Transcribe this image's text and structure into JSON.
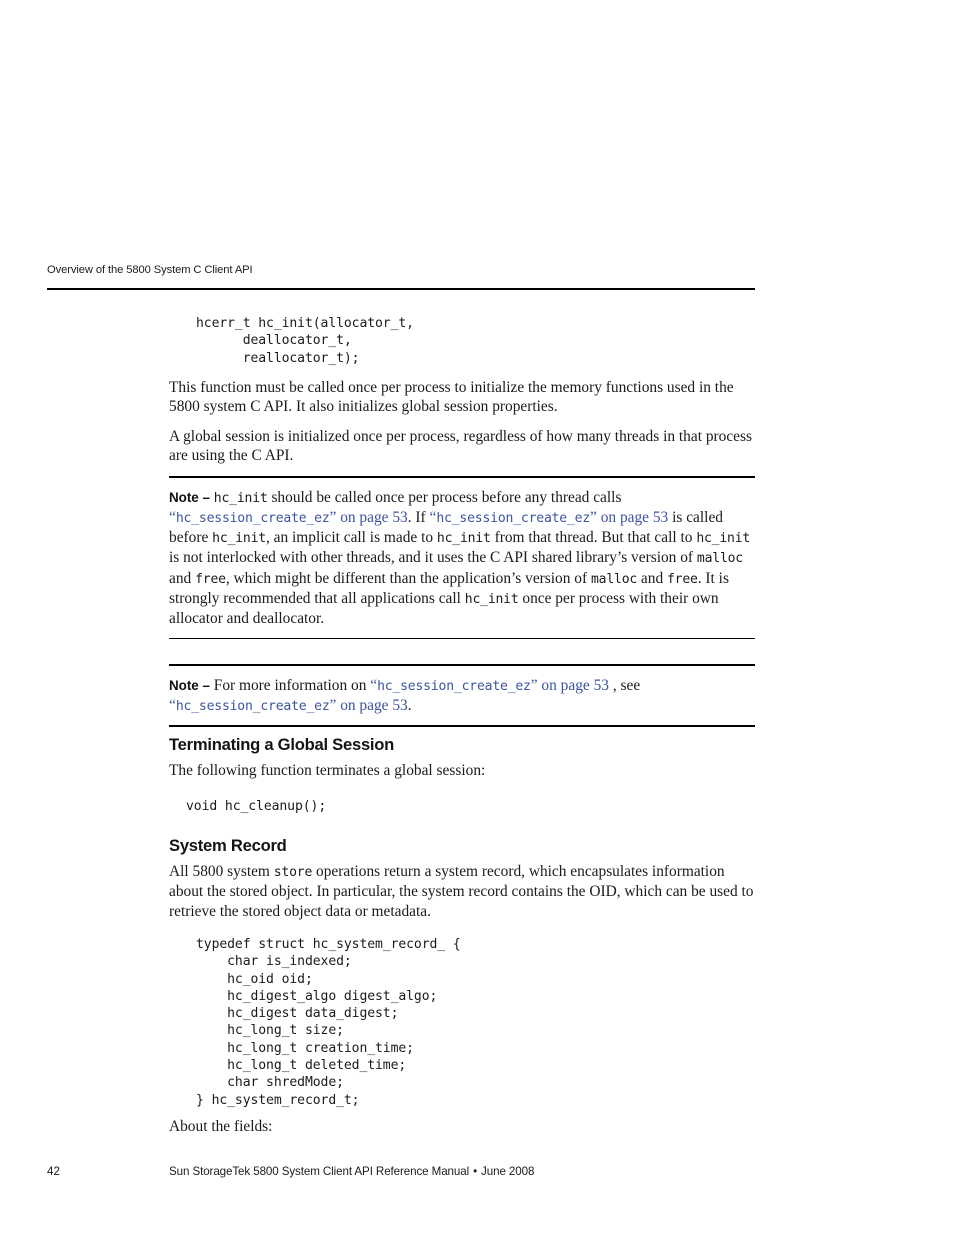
{
  "page": {
    "running_header": "Overview of the 5800 System C Client API",
    "number": "42",
    "footer_title": "Sun StorageTek 5800 System Client API Reference Manual",
    "footer_separator": "•",
    "footer_date": "June 2008",
    "link_color": "#3d53a0"
  },
  "code_blocks": {
    "hc_init_signature": "hcerr_t hc_init(allocator_t,\n      deallocator_t,\n      reallocator_t);",
    "hc_cleanup": "void hc_cleanup();",
    "system_record_struct": "typedef struct hc_system_record_ {\n    char is_indexed;\n    hc_oid oid;\n    hc_digest_algo digest_algo;\n    hc_digest data_digest;\n    hc_long_t size;\n    hc_long_t creation_time;\n    hc_long_t deleted_time;\n    char shredMode;\n} hc_system_record_t;"
  },
  "paragraphs": {
    "intro_1": "This function must be called once per process to initialize the memory functions used in the 5800 system C API. It also initializes global session properties.",
    "intro_2": "A global session is initialized once per process, regardless of how many threads in that process are using the C API.",
    "after_heading_1": "The following function terminates a global session:",
    "about_fields": "About the fields:"
  },
  "notes": {
    "note_label": "Note –",
    "note_1": {
      "seg_1": " ",
      "code_1": "hc_init",
      "seg_2": " should be called once per process before any thread calls ",
      "link_1_open_quote": "“",
      "link_1_code": "hc_session_create_ez",
      "link_1_close": "” on page 53",
      "seg_3": ". If ",
      "link_2_open_quote": "“",
      "link_2_code": "hc_session_create_ez",
      "link_2_close": "” on page 53",
      "seg_4": " is called before ",
      "code_2": "hc_init",
      "seg_5": ", an implicit call is made to ",
      "code_3": "hc_init",
      "seg_6": " from that thread. But that call to ",
      "code_4": "hc_init",
      "seg_7": " is not interlocked with other threads, and it uses the C API shared library’s version of ",
      "code_5": "malloc",
      "seg_8": " and ",
      "code_6": "free",
      "seg_9": ", which might be different than the application’s version of ",
      "code_7": "malloc",
      "seg_10": " and ",
      "code_8": "free",
      "seg_11": ". It is strongly recommended that all applications call ",
      "code_9": "hc_init",
      "seg_12": " once per process with their own allocator and deallocator."
    },
    "note_2": {
      "seg_1": " For more information on ",
      "link_1_open_quote": "“",
      "link_1_code": "hc_session_create_ez",
      "link_1_close": "” on page 53",
      "seg_2": " , see ",
      "link_2_open_quote": "“",
      "link_2_code": "hc_session_create_ez",
      "link_2_close": "” on page 53",
      "seg_3": "."
    }
  },
  "headings": {
    "terminating_a_global_session": "Terminating a Global Session",
    "system_record": "System Record"
  },
  "system_record_text": {
    "seg_1": "All 5800 system ",
    "code_1": "store",
    "seg_2": " operations return a system record, which encapsulates information about the stored object. In particular, the system record contains the OID, which can be used to retrieve the stored object data or metadata."
  }
}
